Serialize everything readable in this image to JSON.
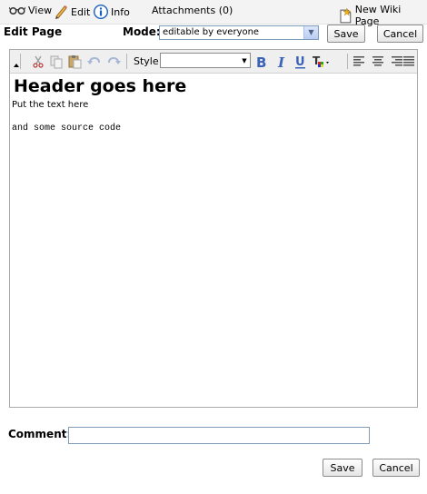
{
  "nav": {
    "view_label": "View",
    "edit_label": "Edit",
    "info_label": "Info",
    "attachments_label": "Attachments (0)",
    "new_page_label": "New Wiki Page"
  },
  "edit": {
    "title": "Edit Page",
    "mode_label": "Mode:",
    "mode_value": "editable by everyone",
    "save_label": "Save",
    "cancel_label": "Cancel"
  },
  "toolbar": {
    "style_label": "Style",
    "style_value": "",
    "icons": [
      "cut-icon",
      "copy-icon",
      "paste-icon",
      "undo-icon",
      "redo-icon",
      "bold-icon",
      "italic-icon",
      "underline-icon",
      "text-color-icon",
      "align-left-icon",
      "align-center-icon",
      "align-right-icon",
      "justify-icon"
    ]
  },
  "content": {
    "heading": "Header goes here",
    "paragraph": "Put the text here",
    "code": "and some source code"
  },
  "comment": {
    "label": "Comment:",
    "value": "",
    "placeholder": ""
  },
  "footer": {
    "save_label": "Save",
    "cancel_label": "Cancel"
  },
  "colors": {
    "topbar_bg": "#f3f3f3",
    "toolbar_bg": "#efefef",
    "info_blue": "#1a5fc0",
    "edit_pencil": "#d99a1a",
    "bold_blue": "#3a63b8"
  }
}
